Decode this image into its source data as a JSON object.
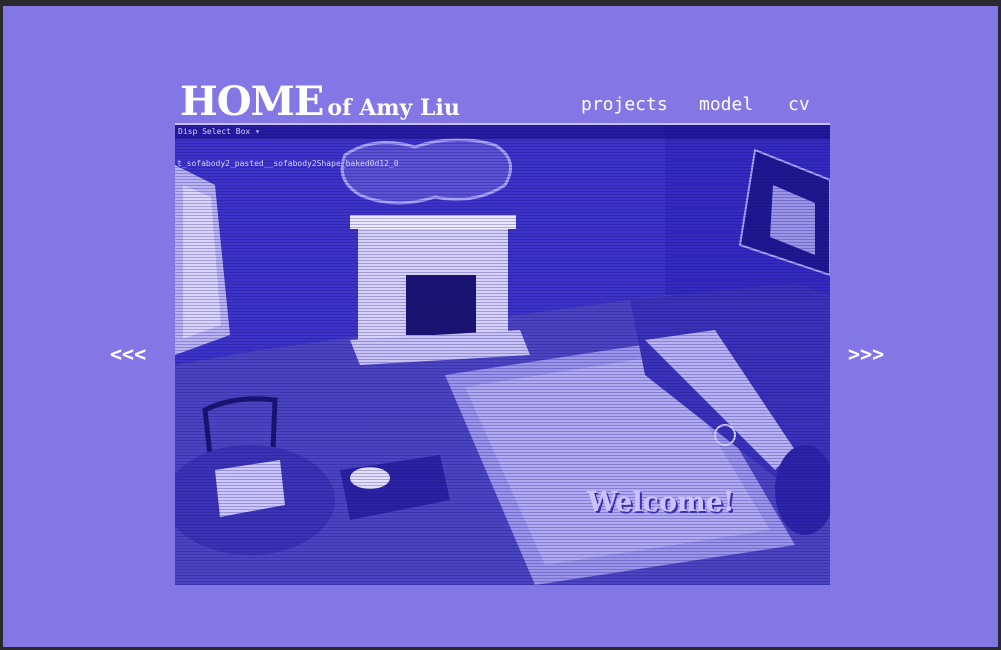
{
  "header": {
    "title_main": "HOME",
    "title_rest": "of Amy Liu"
  },
  "nav": {
    "items": [
      "projects",
      "model",
      "cv"
    ]
  },
  "carousel": {
    "prev_label": "<<<",
    "next_label": ">>>"
  },
  "viewport": {
    "toolbar_text": "Disp    Select Box ▾",
    "object_label": "t_sofabody2_pasted__sofabody2Shape_baked0d12_0",
    "overlay_text": "Welcome!"
  },
  "colors": {
    "page_bg": "#8377e6",
    "viewport_bg": "#2e26c0",
    "text": "#ffffff"
  }
}
